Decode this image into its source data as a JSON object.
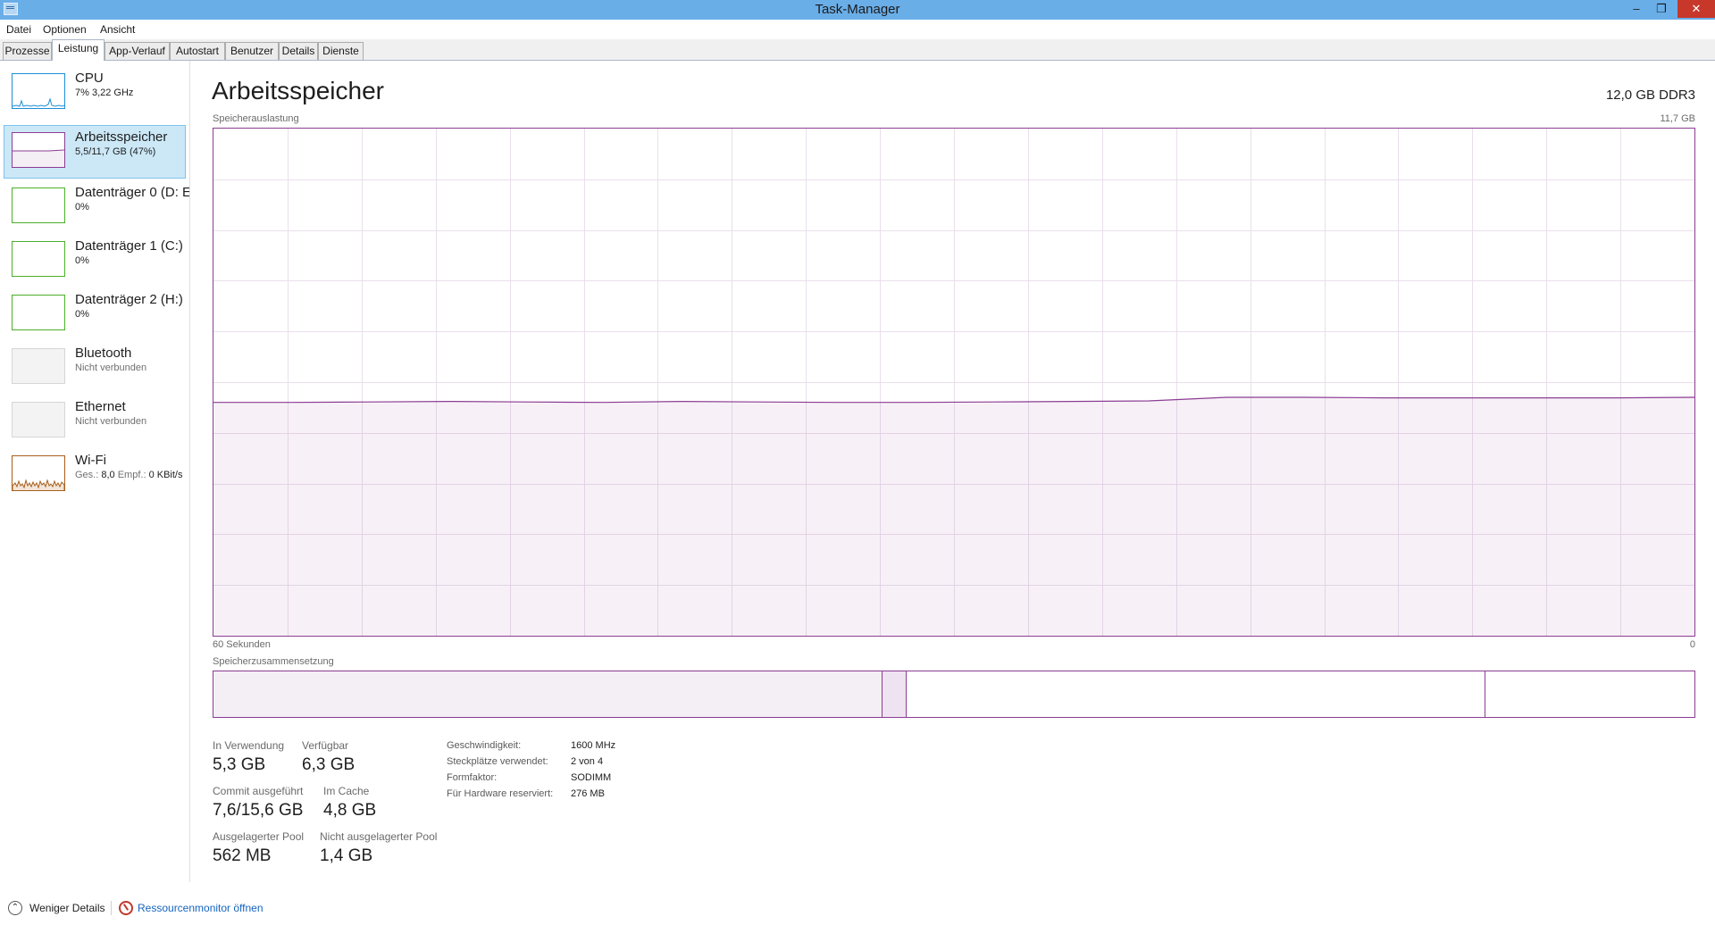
{
  "window": {
    "title": "Task-Manager",
    "buttons": {
      "minimize": "–",
      "maximize": "❐",
      "close": "✕"
    }
  },
  "menu": [
    "Datei",
    "Optionen",
    "Ansicht"
  ],
  "tabs": [
    "Prozesse",
    "Leistung",
    "App-Verlauf",
    "Autostart",
    "Benutzer",
    "Details",
    "Dienste"
  ],
  "active_tab": "Leistung",
  "sidebar": {
    "items": [
      {
        "title": "CPU",
        "subtitle": "7%  3,22 GHz",
        "color": "#1c8fd6"
      },
      {
        "title": "Arbeitsspeicher",
        "subtitle": "5,5/11,7 GB (47%)",
        "color": "#8b3c93",
        "selected": true
      },
      {
        "title": "Datenträger 0 (D: E",
        "subtitle": "0%",
        "color": "#4caf2a"
      },
      {
        "title": "Datenträger 1 (C:)",
        "subtitle": "0%",
        "color": "#4caf2a"
      },
      {
        "title": "Datenträger 2 (H:)",
        "subtitle": "0%",
        "color": "#4caf2a"
      },
      {
        "title": "Bluetooth",
        "subtitle": "Nicht verbunden",
        "color": "#c8c8c8"
      },
      {
        "title": "Ethernet",
        "subtitle": "Nicht verbunden",
        "color": "#c8c8c8"
      },
      {
        "title": "Wi-Fi",
        "subtitle_gray_1": "Ges.:",
        "subtitle_value_1": "8,0",
        "subtitle_gray_2": "Empf.:",
        "subtitle_value_2": "0 KBit/s",
        "color": "#a75d1c"
      }
    ]
  },
  "main": {
    "title": "Arbeitsspeicher",
    "spec": "12,0 GB DDR3",
    "graph_label": "Speicherauslastung",
    "graph_max": "11,7 GB",
    "time_label": "60 Sekunden",
    "time_end": "0",
    "composition_label": "Speicherzusammensetzung",
    "usage_fraction_history": [
      0.46,
      0.46,
      0.461,
      0.462,
      0.461,
      0.46,
      0.462,
      0.461,
      0.46,
      0.46,
      0.461,
      0.462,
      0.463,
      0.47,
      0.47,
      0.469,
      0.469,
      0.469,
      0.469,
      0.47
    ],
    "composition": {
      "in_use": 0.452,
      "modified": 0.016,
      "standby": 0.391,
      "free": 0.141
    }
  },
  "stats": {
    "in_use": {
      "label": "In Verwendung",
      "value": "5,3 GB"
    },
    "available": {
      "label": "Verfügbar",
      "value": "6,3 GB"
    },
    "committed": {
      "label": "Commit ausgeführt",
      "value": "7,6/15,6 GB"
    },
    "cached": {
      "label": "Im Cache",
      "value": "4,8 GB"
    },
    "paged_pool": {
      "label": "Ausgelagerter Pool",
      "value": "562 MB"
    },
    "nonpaged_pool": {
      "label": "Nicht ausgelagerter Pool",
      "value": "1,4 GB"
    }
  },
  "specs": [
    {
      "label": "Geschwindigkeit:",
      "value": "1600 MHz"
    },
    {
      "label": "Steckplätze verwendet:",
      "value": "2 von 4"
    },
    {
      "label": "Formfaktor:",
      "value": "SODIMM"
    },
    {
      "label": "Für Hardware reserviert:",
      "value": "276 MB"
    }
  ],
  "footer": {
    "fewer_details": "Weniger Details",
    "resource_monitor": "Ressourcenmonitor öffnen"
  }
}
